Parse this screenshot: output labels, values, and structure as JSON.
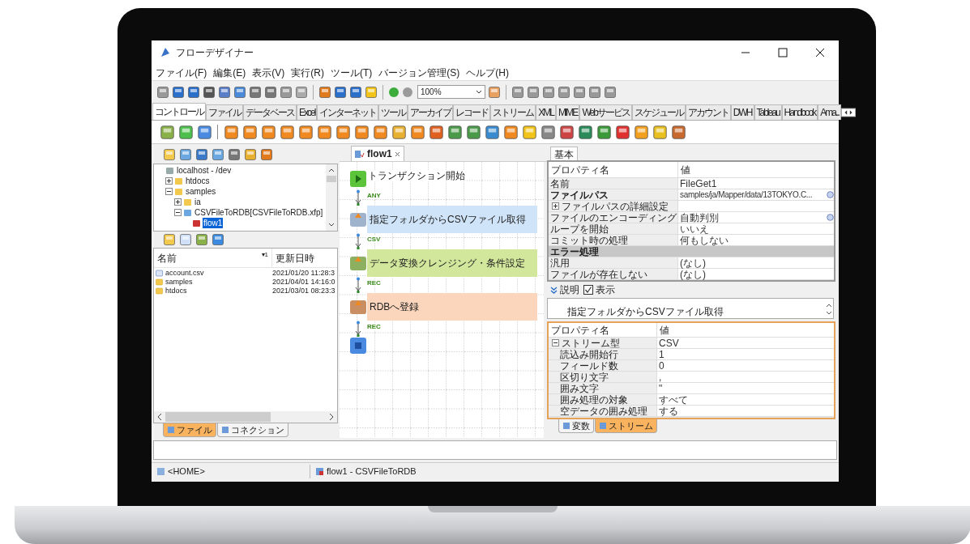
{
  "window": {
    "title": "フローデザイナー"
  },
  "menu": [
    "ファイル(F)",
    "編集(E)",
    "表示(V)",
    "実行(R)",
    "ツール(T)",
    "バージョン管理(S)",
    "ヘルプ(H)"
  ],
  "toolbar": {
    "zoom": "100%"
  },
  "palette_tabs": [
    {
      "label": "コントロール",
      "selected": true
    },
    {
      "label": "ファイル",
      "selected": false
    },
    {
      "label": "データベース",
      "selected": false
    },
    {
      "label": "Excel",
      "selected": false
    },
    {
      "label": "インターネット",
      "selected": false
    },
    {
      "label": "ツール",
      "selected": false
    },
    {
      "label": "アーカイブ",
      "selected": false
    },
    {
      "label": "レコード",
      "selected": false
    },
    {
      "label": "ストリーム",
      "selected": false
    },
    {
      "label": "XML",
      "selected": false
    },
    {
      "label": "MIME",
      "selected": false
    },
    {
      "label": "Webサービス",
      "selected": false
    },
    {
      "label": "スケジュール",
      "selected": false
    },
    {
      "label": "アカウント",
      "selected": false
    },
    {
      "label": "DWH",
      "selected": false
    },
    {
      "label": "Tableau",
      "selected": false
    },
    {
      "label": "Handbook",
      "selected": false
    },
    {
      "label": "Ama...",
      "selected": false
    }
  ],
  "explorer": {
    "tree": [
      {
        "label": "localhost - /dev",
        "kind": "server",
        "selected": false,
        "children": [
          {
            "label": "htdocs",
            "kind": "folder",
            "expanded": false,
            "selected": false
          },
          {
            "label": "samples",
            "kind": "folder",
            "expanded": true,
            "selected": false,
            "children": [
              {
                "label": "ia",
                "kind": "folder",
                "expanded": false,
                "selected": false
              },
              {
                "label": "CSVFileToRDB[CSVFileToRDB.xfp]",
                "kind": "project",
                "expanded": true,
                "selected": false,
                "children": [
                  {
                    "label": "flow1",
                    "kind": "flow",
                    "selected": true
                  }
                ]
              }
            ]
          }
        ]
      }
    ],
    "columns": [
      "名前",
      "更新日時"
    ],
    "sort_mark": "▾1",
    "files": [
      {
        "kind": "csv",
        "name": "account.csv",
        "date": "2021/01/20 11:28:3"
      },
      {
        "kind": "folder",
        "name": "samples",
        "date": "2021/04/01 14:16:0"
      },
      {
        "kind": "folder",
        "name": "htdocs",
        "date": "2021/03/01 08:23:3"
      }
    ],
    "tabs": [
      {
        "label": "ファイル",
        "selected": true
      },
      {
        "label": "コネクション",
        "selected": false
      }
    ]
  },
  "canvas": {
    "tab": "flow1",
    "nodes": [
      {
        "kind": "start",
        "label": "トランザクション開始",
        "port": "ANY"
      },
      {
        "kind": "file",
        "label": "指定フォルダからCSVファイル取得",
        "port": "CSV",
        "color": "#cfe4f8"
      },
      {
        "kind": "mapper",
        "label": "データ変換クレンジング・条件設定",
        "port": "REC",
        "color": "#d3e79c"
      },
      {
        "kind": "db",
        "label": "RDBへ登録",
        "port": "REC",
        "color": "#fbd6bd"
      },
      {
        "kind": "end"
      }
    ]
  },
  "properties": {
    "tab": "基本",
    "columns": [
      "プロパティ名",
      "値"
    ],
    "rows": [
      {
        "kind": "normal",
        "name": "名前",
        "value": "FileGet1",
        "button": false
      },
      {
        "kind": "bold",
        "name": "ファイルパス",
        "value": "samples/ja/Mapper/data/13TOKYO.C...",
        "button": true
      },
      {
        "kind": "group",
        "name": "ファイルパスの詳細設定",
        "value": "",
        "button": false,
        "expanded": false
      },
      {
        "kind": "normal",
        "name": "ファイルのエンコーディング",
        "value": "自動判別",
        "button": true
      },
      {
        "kind": "normal",
        "name": "ループを開始",
        "value": "いいえ",
        "button": false
      },
      {
        "kind": "normal",
        "name": "コミット時の処理",
        "value": "何もしない",
        "button": false
      },
      {
        "kind": "section",
        "name": "エラー処理"
      },
      {
        "kind": "normal",
        "name": "汎用",
        "value": "(なし)",
        "button": false
      },
      {
        "kind": "normal",
        "name": "ファイルが存在しない",
        "value": "(なし)",
        "button": false
      }
    ],
    "description": {
      "label": "説明",
      "show_label": "表示",
      "checked": true,
      "text": "指定フォルダからCSVファイル取得"
    }
  },
  "stream": {
    "columns": [
      "プロパティ名",
      "値"
    ],
    "rows": [
      {
        "kind": "group",
        "name": "ストリーム型",
        "value": "CSV",
        "expanded": true
      },
      {
        "kind": "child",
        "name": "読込み開始行",
        "value": "1"
      },
      {
        "kind": "child",
        "name": "フィールド数",
        "value": "0"
      },
      {
        "kind": "child",
        "name": "区切り文字",
        "value": ","
      },
      {
        "kind": "child",
        "name": "囲み文字",
        "value": "\""
      },
      {
        "kind": "child",
        "name": "囲み処理の対象",
        "value": "すべて"
      },
      {
        "kind": "child",
        "name": "空データの囲み処理",
        "value": "する"
      }
    ],
    "tabs": [
      {
        "label": "変数",
        "selected": false
      },
      {
        "label": "ストリーム",
        "selected": true
      }
    ]
  },
  "status_bar": [
    "<HOME>",
    "flow1 - CSVFileToRDB"
  ]
}
